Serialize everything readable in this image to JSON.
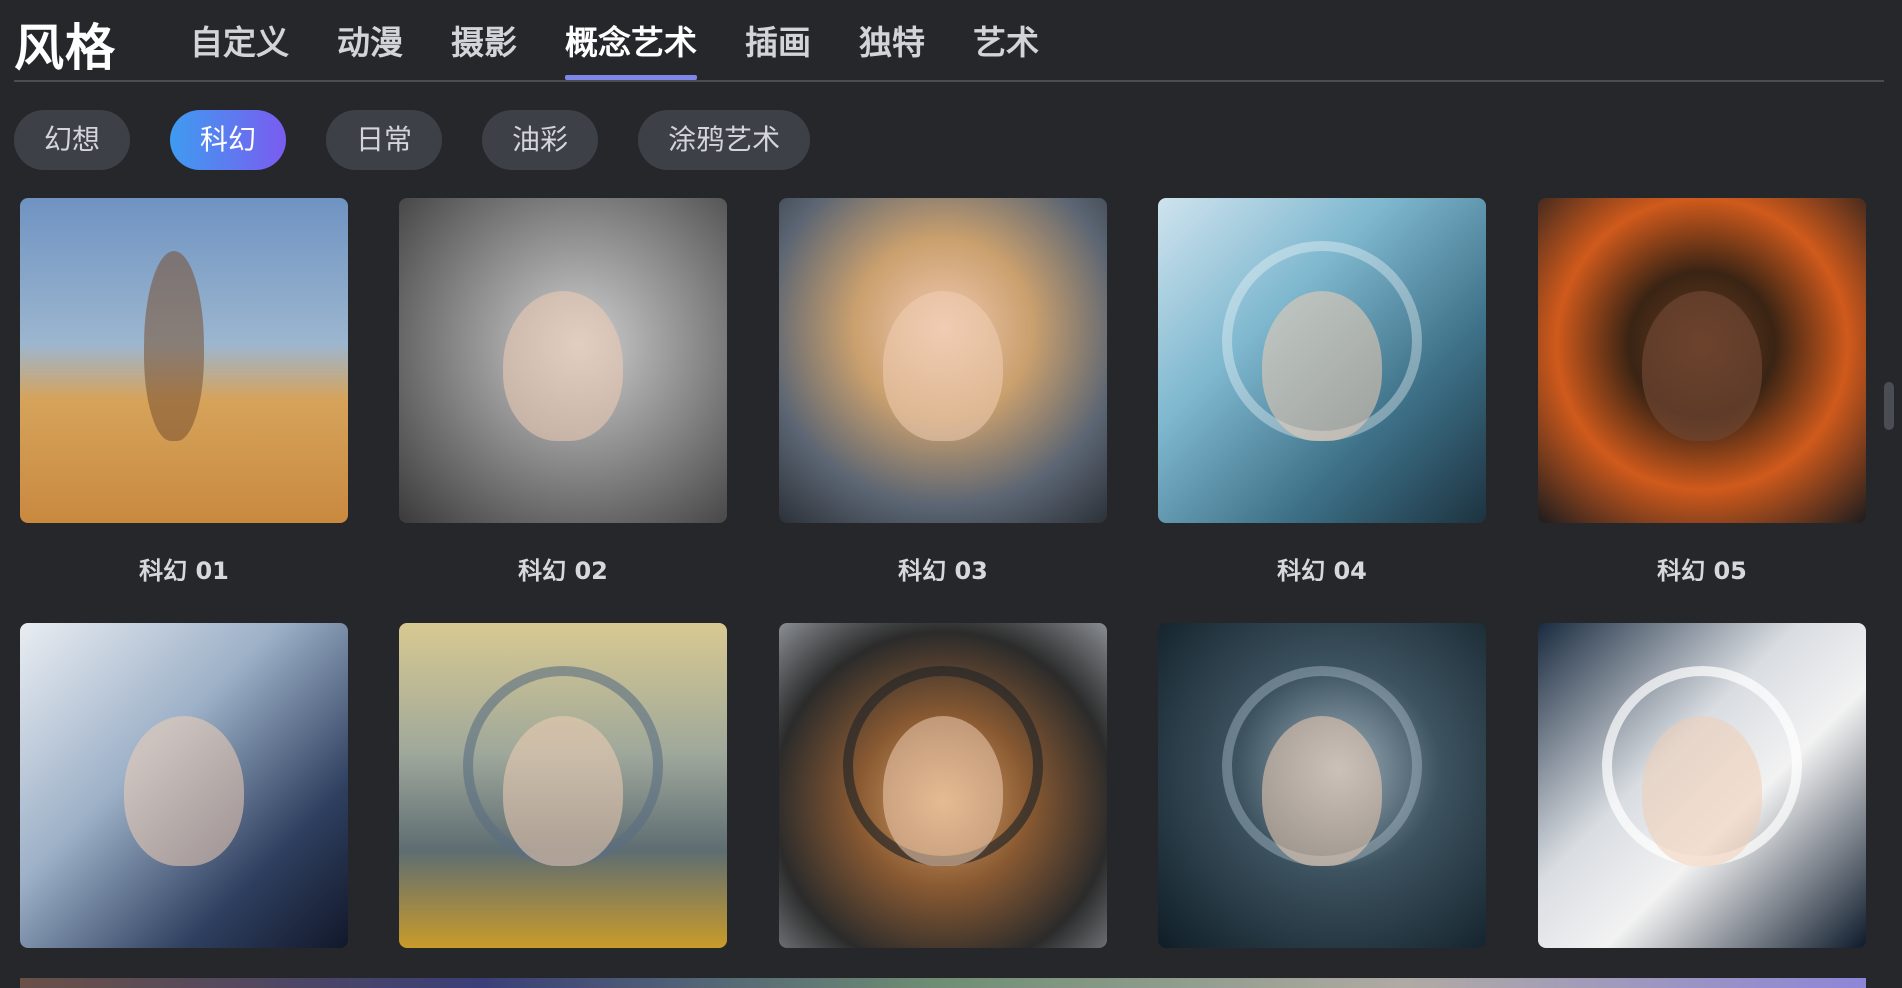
{
  "header": {
    "title": "风格",
    "tabs": [
      {
        "label": "自定义",
        "active": false
      },
      {
        "label": "动漫",
        "active": false
      },
      {
        "label": "摄影",
        "active": false
      },
      {
        "label": "概念艺术",
        "active": true
      },
      {
        "label": "插画",
        "active": false
      },
      {
        "label": "独特",
        "active": false
      },
      {
        "label": "艺术",
        "active": false
      }
    ]
  },
  "chips": [
    {
      "label": "幻想",
      "active": false
    },
    {
      "label": "科幻",
      "active": true
    },
    {
      "label": "日常",
      "active": false
    },
    {
      "label": "油彩",
      "active": false
    },
    {
      "label": "涂鸦艺术",
      "active": false
    }
  ],
  "cards": [
    {
      "caption": "科幻 01"
    },
    {
      "caption": "科幻 02"
    },
    {
      "caption": "科幻 03"
    },
    {
      "caption": "科幻 04"
    },
    {
      "caption": "科幻 05"
    },
    {
      "caption": ""
    },
    {
      "caption": ""
    },
    {
      "caption": ""
    },
    {
      "caption": ""
    },
    {
      "caption": ""
    }
  ],
  "colors": {
    "background": "#25272b",
    "tab_underline": "#7f86ea",
    "chip_active_start": "#3f9bf0",
    "chip_active_end": "#7a5cf0",
    "chip_bg": "#3d4047"
  }
}
